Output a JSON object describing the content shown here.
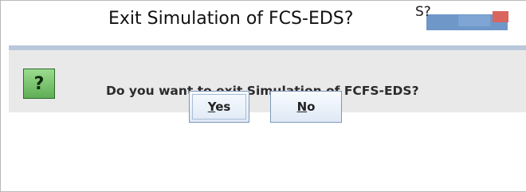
{
  "window": {
    "title": "Exit Simulation of FCS-EDS?",
    "title_overlay_text": "S?"
  },
  "dialog": {
    "icon": "question-icon",
    "icon_glyph": "?",
    "message": "Do you want to exit Simulation of FCFS-EDS?"
  },
  "buttons": {
    "yes": {
      "mnemonic": "Y",
      "rest": "es"
    },
    "no": {
      "mnemonic": "N",
      "rest": "o"
    }
  },
  "colors": {
    "icon_green": "#5fae55",
    "accent_blue": "#b9c8da",
    "button_border": "#7e98b8"
  }
}
